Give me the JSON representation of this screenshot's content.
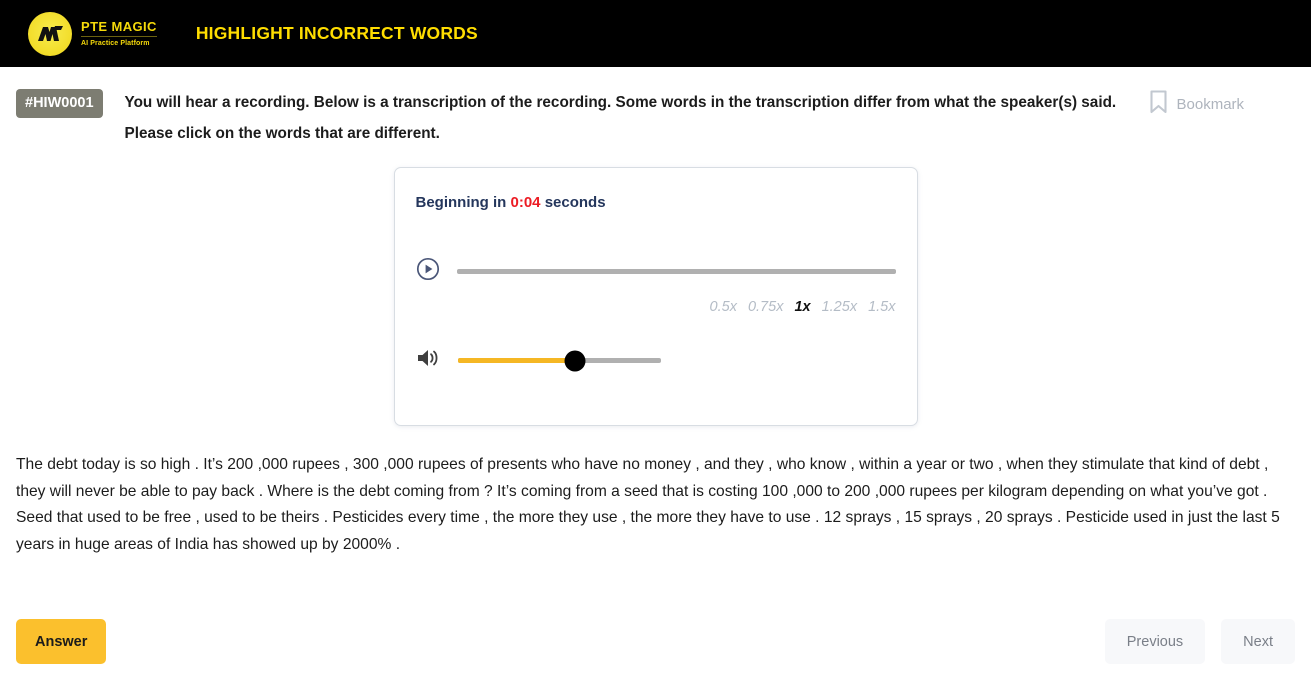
{
  "header": {
    "logo_name": "PTE MAGIC",
    "logo_tagline": "AI Practice Platform",
    "title": "HIGHLIGHT INCORRECT WORDS",
    "brand_yellow": "#ffdd00",
    "background": "#000000"
  },
  "question": {
    "id_badge": "#HIW0001",
    "instruction": "You will hear a recording. Below is a transcription of the recording. Some words in the transcription differ from what the speaker(s) said. Please click on the words that are different.",
    "bookmark_label": "Bookmark"
  },
  "player": {
    "countdown_prefix": "Beginning in",
    "countdown_time": "0:04",
    "countdown_suffix": "seconds",
    "countdown_time_color": "#ec1c24",
    "progress_percent": 0,
    "volume_percent": 58,
    "volume_fill_color": "#f5b724",
    "speeds": [
      {
        "label": "0.5x",
        "active": false
      },
      {
        "label": "0.75x",
        "active": false
      },
      {
        "label": "1x",
        "active": true
      },
      {
        "label": "1.25x",
        "active": false
      },
      {
        "label": "1.5x",
        "active": false
      }
    ]
  },
  "transcript": {
    "text": "The debt today is so high . It’s 200 ,000 rupees , 300 ,000 rupees of presents who have no money , and they , who know , within a year or two , when they stimulate that kind of debt , they will never be able to pay back . Where is the debt coming from ? It’s coming from a seed that is costing 100 ,000 to 200 ,000 rupees per kilogram depending on what you’ve got . Seed that used to be free , used to be theirs . Pesticides every time , the more they use , the more they have to use . 12 sprays , 15 sprays , 20 sprays . Pesticide used in just the last 5 years in huge areas of India has showed up by 2000% ."
  },
  "footer": {
    "answer_label": "Answer",
    "previous_label": "Previous",
    "next_label": "Next",
    "answer_color": "#fbc02d"
  }
}
